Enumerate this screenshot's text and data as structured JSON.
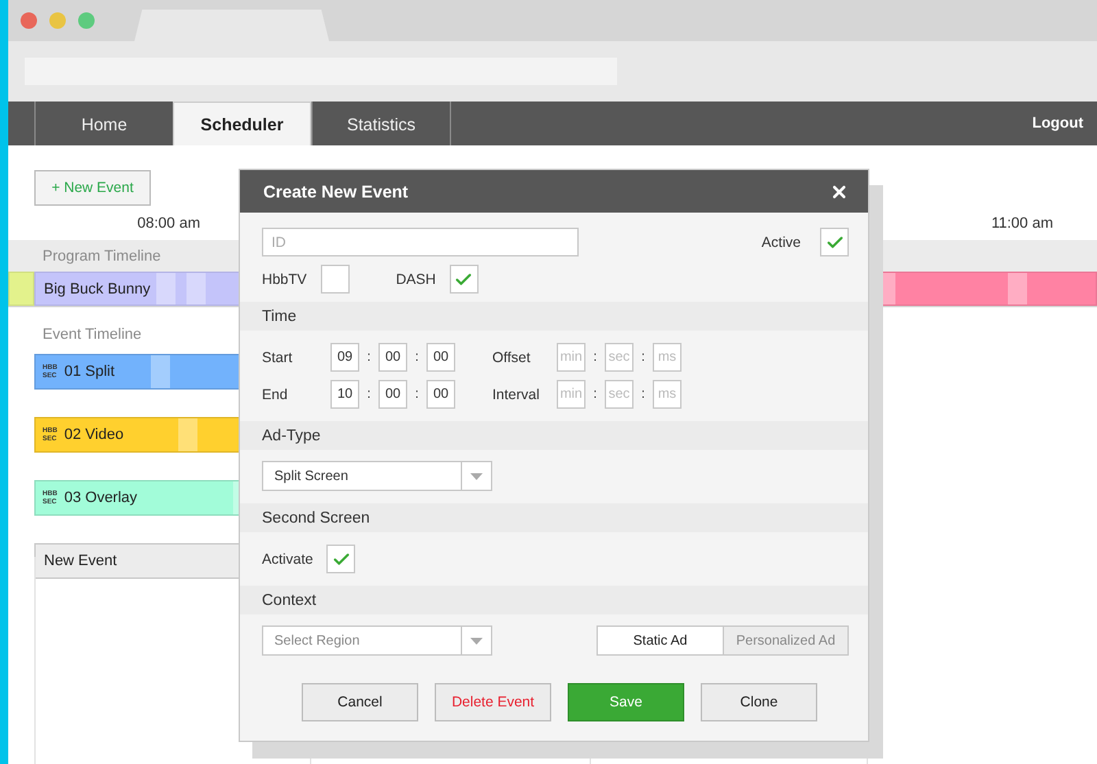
{
  "nav": {
    "tabs": [
      {
        "label": "Home",
        "selected": false
      },
      {
        "label": "Scheduler",
        "selected": true
      },
      {
        "label": "Statistics",
        "selected": false
      }
    ],
    "logout": "Logout"
  },
  "toolbar": {
    "new_event": "+ New Event"
  },
  "timeline": {
    "time_labels": [
      "08:00 am",
      "11:00 am"
    ],
    "program_label": "Program Timeline",
    "program_segments": [
      {
        "color": "#e3f28c"
      },
      {
        "title": "Big Buck Bunny",
        "color": "#c4c4fa"
      },
      {
        "color": "#ff82a3"
      }
    ],
    "event_label": "Event Timeline",
    "events": [
      {
        "kind": "event",
        "badge": [
          "HBB",
          "SEC"
        ],
        "title": "01 Split",
        "color": "#72b2fc"
      },
      {
        "kind": "event",
        "badge": [
          "HBB",
          "SEC"
        ],
        "title": "02 Video",
        "color": "#ffd02e"
      },
      {
        "kind": "event",
        "badge": [
          "HBB",
          "SEC"
        ],
        "title": "03 Overlay",
        "color": "#a2fcd9"
      },
      {
        "kind": "draft",
        "title": "New Event"
      }
    ]
  },
  "dialog": {
    "title": "Create New Event",
    "id_field": {
      "placeholder": "ID"
    },
    "active": {
      "label": "Active",
      "checked": true
    },
    "flags": [
      {
        "label": "HbbTV",
        "checked": false
      },
      {
        "label": "DASH",
        "checked": true
      }
    ],
    "time": {
      "heading": "Time",
      "separator": ":",
      "rows": [
        {
          "label": "Start",
          "values": [
            "09",
            "00",
            "00"
          ],
          "extra_label": "Offset",
          "extra_placeholders": [
            "min",
            "sec",
            "ms"
          ]
        },
        {
          "label": "End",
          "values": [
            "10",
            "00",
            "00"
          ],
          "extra_label": "Interval",
          "extra_placeholders": [
            "min",
            "sec",
            "ms"
          ]
        }
      ]
    },
    "ad_type": {
      "heading": "Ad-Type",
      "value": "Split Screen"
    },
    "second_screen": {
      "heading": "Second Screen",
      "label": "Activate",
      "checked": true
    },
    "context": {
      "heading": "Context",
      "region_placeholder": "Select Region",
      "ad_modes": [
        {
          "label": "Static Ad",
          "selected": true
        },
        {
          "label": "Personalized Ad",
          "selected": false
        }
      ]
    },
    "buttons": [
      {
        "label": "Cancel",
        "kind": "plain"
      },
      {
        "label": "Delete Event",
        "kind": "danger"
      },
      {
        "label": "Save",
        "kind": "primary"
      },
      {
        "label": "Clone",
        "kind": "plain"
      }
    ]
  }
}
